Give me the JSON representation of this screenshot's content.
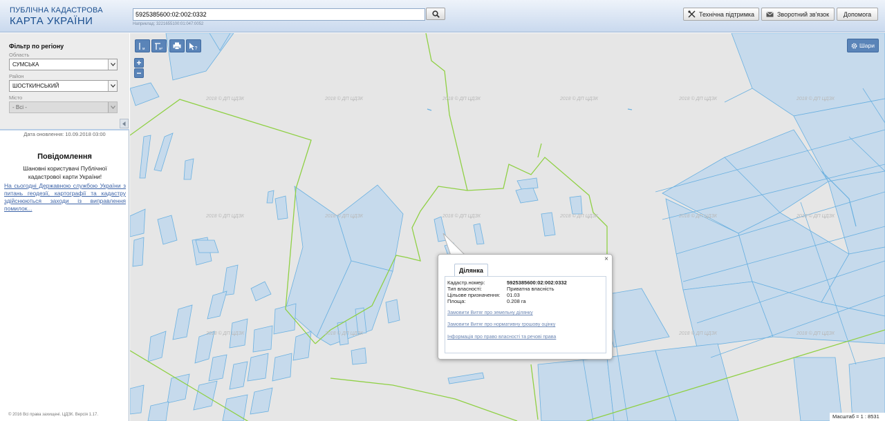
{
  "header": {
    "logo_line1": "ПУБЛІЧНА КАДАСТРОВА",
    "logo_line2": "КАРТА УКРАЇНИ",
    "search_value": "5925385600:02:002:0332",
    "search_hint": "Наприклад: 3221655100:01:047:0052",
    "buttons": [
      {
        "label": "Технічна підтримка",
        "icon": "tools-icon"
      },
      {
        "label": "Зворотний зв'язок",
        "icon": "envelope-icon"
      },
      {
        "label": "Допомога",
        "icon": ""
      }
    ]
  },
  "filter": {
    "title": "Фільтр по регіону",
    "region_label": "Область",
    "region_value": "СУМСЬКА",
    "district_label": "Район",
    "district_value": "ШОСТКИНСЬКИЙ",
    "city_label": "Місто",
    "city_value": "- Всі -"
  },
  "sidebar": {
    "updated": "Дата оновлення: 10.09.2018 03:00",
    "notice_title": "Повідомлення",
    "notice_text": "Шановні користувачі Публічної кадастрової карти України!",
    "notice_link": "На сьогодні Державною службою України з питань геодезії, картографії та кадастру здійснюються заходи із виправлення помилок...",
    "copyright": "© 2016 Всі права захищені. ЦДЗК. Версія 1.17."
  },
  "map": {
    "layers_label": "Шари",
    "zoom_in": "+",
    "zoom_out": "−",
    "watermark": "2018 © ДП ЦДЗК",
    "scale_label": "Масштаб = 1 : 8531",
    "tools": [
      "measure-distance-icon",
      "measure-area-icon",
      "print-icon",
      "identify-icon"
    ]
  },
  "popup": {
    "tab_label": "Ділянка",
    "close": "×",
    "rows": [
      {
        "key": "Кадастр.номер:",
        "value": "5925385600:02:002:0332"
      },
      {
        "key": "Тип власності:",
        "value": "Приватна власність"
      },
      {
        "key": "Цільове призначення:",
        "value": "01.03"
      },
      {
        "key": "Площа:",
        "value": "0.208 га"
      }
    ],
    "links": [
      "Замовити Витяг про земельну ділянку",
      "Замовити Витяг про нормативну грошову оцінку",
      "Інформація про право власності та речові права"
    ]
  },
  "colors": {
    "header_text": "#1b4f8f",
    "parcel_fill": "#c6daec",
    "parcel_stroke": "#6ab0e0",
    "boundary": "#8fd044",
    "tool_button": "#5a84b8"
  }
}
